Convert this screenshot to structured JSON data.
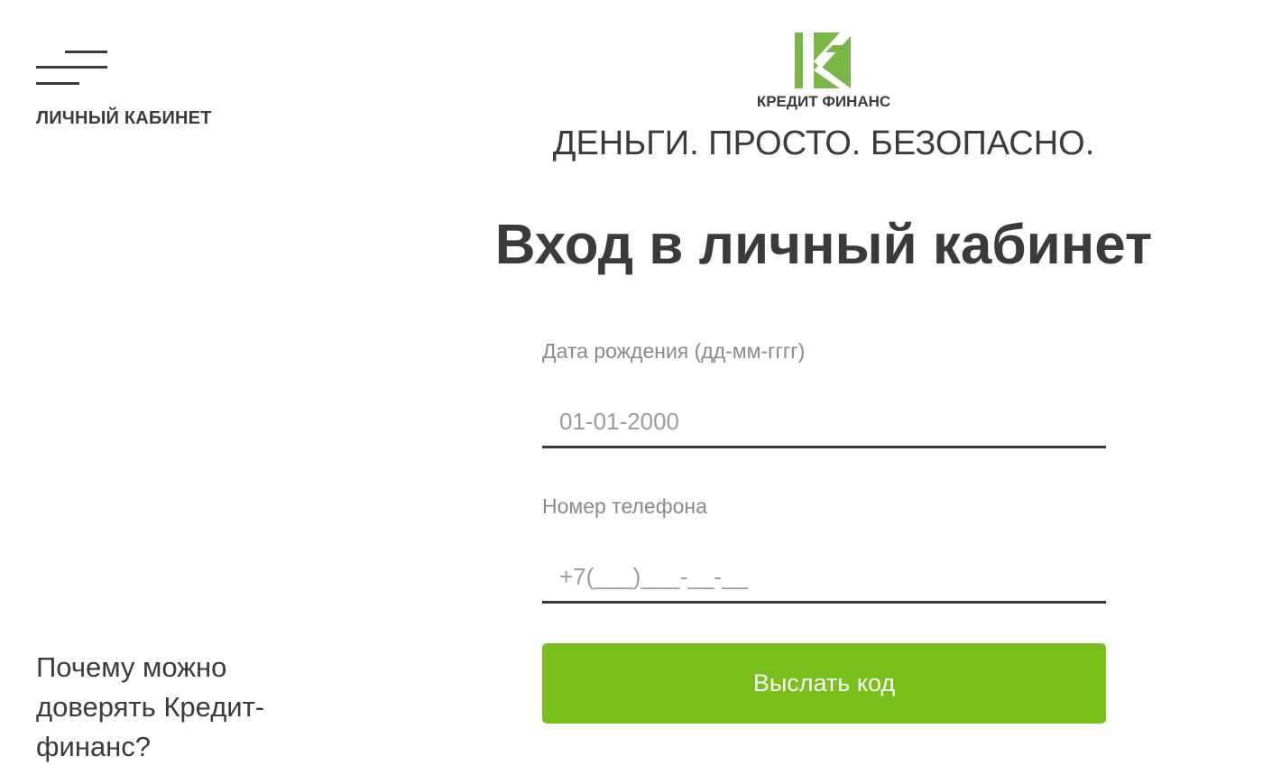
{
  "header": {
    "menu_icon": "hamburger-menu-icon",
    "cabinet_link": "ЛИЧНЫЙ КАБИНЕТ",
    "logo_icon": "kredit-finans-logo-icon",
    "brand_name": "КРЕДИТ ФИНАНС",
    "slogan": "ДЕНЬГИ. ПРОСТО. БЕЗОПАСНО."
  },
  "main": {
    "title": "Вход в личный кабинет",
    "form": {
      "birthdate": {
        "label": "Дата рождения (дд-мм-гггг)",
        "placeholder": "01-01-2000",
        "value": ""
      },
      "phone": {
        "label": "Номер телефона",
        "placeholder": "+7(___)___-__-__",
        "value": ""
      },
      "submit_label": "Выслать код"
    }
  },
  "sidebar": {
    "trust_link": "Почему можно доверять Кредит-финанс?"
  },
  "colors": {
    "accent": "#79c11a",
    "logo_green": "#7ab648",
    "text": "#3b3b3b",
    "muted": "#8a8a8a"
  }
}
